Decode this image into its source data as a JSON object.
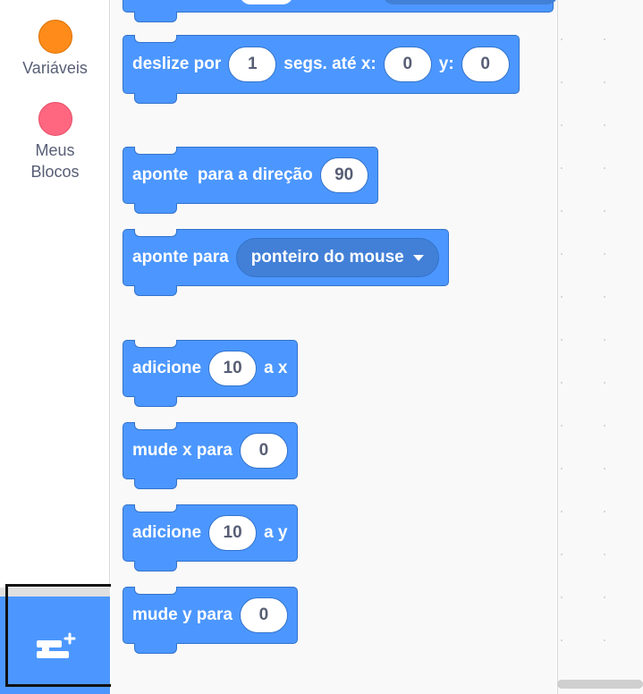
{
  "sidebar": {
    "categories": [
      {
        "label": "Variáveis",
        "color": "#ff8c1a"
      },
      {
        "label": "Meus Blocos",
        "color": "#ff6680"
      }
    ],
    "extension_button": {
      "icon": "add-extension-icon"
    }
  },
  "palette": {
    "blocks": [
      {
        "id": "glide",
        "text1": "deslize por",
        "input1": "1",
        "text2": "segs. até x:",
        "input2": "0",
        "text3": "y:",
        "input3": "0"
      },
      {
        "id": "point-direction",
        "text1": "aponte  para a direção",
        "input1": "90"
      },
      {
        "id": "point-towards",
        "text1": "aponte para",
        "dropdown": "ponteiro do mouse"
      },
      {
        "id": "change-x",
        "text1": "adicione",
        "input1": "10",
        "text2": "a x"
      },
      {
        "id": "set-x",
        "text1": "mude x para",
        "input1": "0"
      },
      {
        "id": "change-y",
        "text1": "adicione",
        "input1": "10",
        "text2": "a y"
      },
      {
        "id": "set-y",
        "text1": "mude y para",
        "input1": "0"
      }
    ]
  },
  "colors": {
    "motion": "#4c97ff",
    "motion_border": "#3373cc",
    "variables": "#ff8c1a",
    "my_blocks": "#ff6680",
    "highlight_border": "#111111"
  }
}
